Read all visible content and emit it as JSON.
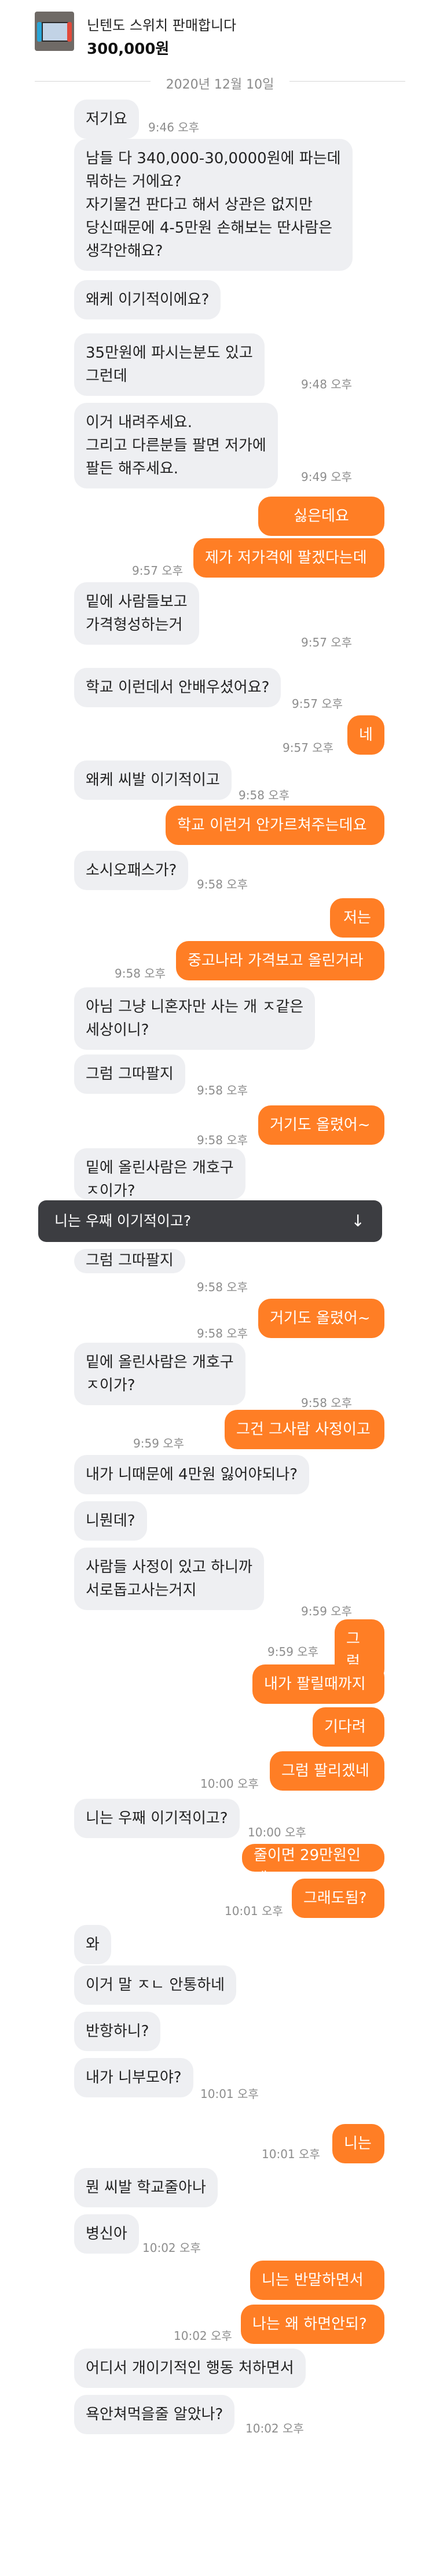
{
  "header": {
    "title": "닌텐도 스위치 판매합니다",
    "price": "300,000원"
  },
  "date_divider": "2020년 12월 10일",
  "toast": {
    "text": "니는 우째 이기적이고?",
    "arrow": "↓"
  },
  "messages": [
    {
      "side": "in",
      "text": "저기요"
    },
    {
      "side": "in",
      "text": "남들 다 340,000-30,0000원에 파는데\n뭐하는 거에요?\n자기물건 판다고 해서 상관은 없지만\n당신때문에 4-5만원 손해보는 딴사람은\n생각안해요?"
    },
    {
      "side": "in",
      "text": "왜케 이기적이에요?"
    },
    {
      "side": "in",
      "text": "35만원에 파시는분도 있고\n그런데"
    },
    {
      "side": "in",
      "text": "이거 내려주세요.\n그리고 다른분들 팔면 저가에\n팔든 해주세요."
    },
    {
      "side": "out",
      "text": "싫은데요"
    },
    {
      "side": "out",
      "text": "제가 저가격에 팔겠다는데"
    },
    {
      "side": "in",
      "text": "밑에 사람들보고\n가격형성하는거"
    },
    {
      "side": "in",
      "text": "학교 이런데서 안배우셨어요?"
    },
    {
      "side": "out",
      "text": "네"
    },
    {
      "side": "in",
      "text": "왜케 씨발 이기적이고"
    },
    {
      "side": "out",
      "text": "학교 이런거 안가르쳐주는데요"
    },
    {
      "side": "in",
      "text": "소시오패스가?"
    },
    {
      "side": "out",
      "text": "저는"
    },
    {
      "side": "out",
      "text": "중고나라 가격보고 올린거라"
    },
    {
      "side": "in",
      "text": "아님 그냥 니혼자만 사는 개 ㅈ같은\n세상이니?"
    },
    {
      "side": "in",
      "text": "그럼 그따팔지"
    },
    {
      "side": "out",
      "text": "거기도 올렸어~"
    },
    {
      "side": "in",
      "text": "밑에 올린사람은 개호구\nㅈ이가?"
    },
    {
      "side": "in",
      "text": "그럼 그따팔지"
    },
    {
      "side": "out",
      "text": "거기도 올렸어~"
    },
    {
      "side": "in",
      "text": "밑에 올린사람은 개호구\nㅈ이가?"
    },
    {
      "side": "out",
      "text": "그건 그사람 사정이고"
    },
    {
      "side": "in",
      "text": "내가 니때문에 4만원 잃어야되나?"
    },
    {
      "side": "in",
      "text": "니뭔데?"
    },
    {
      "side": "in",
      "text": "사람들 사정이 있고 하니까\n서로돕고사는거지"
    },
    {
      "side": "out",
      "text": "그럼"
    },
    {
      "side": "out",
      "text": "내가 팔릴때까지"
    },
    {
      "side": "out",
      "text": "기다려"
    },
    {
      "side": "out",
      "text": "그럼 팔리겠네"
    },
    {
      "side": "in",
      "text": "니는 우째 이기적이고?"
    },
    {
      "side": "out",
      "text": "줄이면 29만원인데"
    },
    {
      "side": "out",
      "text": "그래도됨?"
    },
    {
      "side": "in",
      "text": "와"
    },
    {
      "side": "in",
      "text": "이거 말 ㅈㄴ 안통하네"
    },
    {
      "side": "in",
      "text": "반항하니?"
    },
    {
      "side": "in",
      "text": "내가 니부모야?"
    },
    {
      "side": "out",
      "text": "니는"
    },
    {
      "side": "in",
      "text": "뭔 씨발 학교줄아나"
    },
    {
      "side": "in",
      "text": "병신아"
    },
    {
      "side": "out",
      "text": "니는 반말하면서"
    },
    {
      "side": "out",
      "text": "나는 왜 하면안되?"
    },
    {
      "side": "in",
      "text": "어디서 개이기적인 행동 처하면서"
    },
    {
      "side": "in",
      "text": "욕안쳐먹을줄 알았나?"
    }
  ],
  "timestamps": [
    "9:46 오후",
    "9:48 오후",
    "9:49 오후",
    "9:57 오후",
    "9:57 오후",
    "9:57 오후",
    "9:57 오후",
    "9:58 오후",
    "9:58 오후",
    "9:58 오후",
    "9:58 오후",
    "9:58 오후",
    "9:58 오후",
    "9:58 오후",
    "9:58 오후",
    "9:59 오후",
    "9:59 오후",
    "9:59 오후",
    "10:00 오후",
    "10:00 오후",
    "10:01 오후",
    "10:01 오후",
    "10:01 오후",
    "10:02 오후",
    "10:02 오후",
    "10:02 오후"
  ]
}
